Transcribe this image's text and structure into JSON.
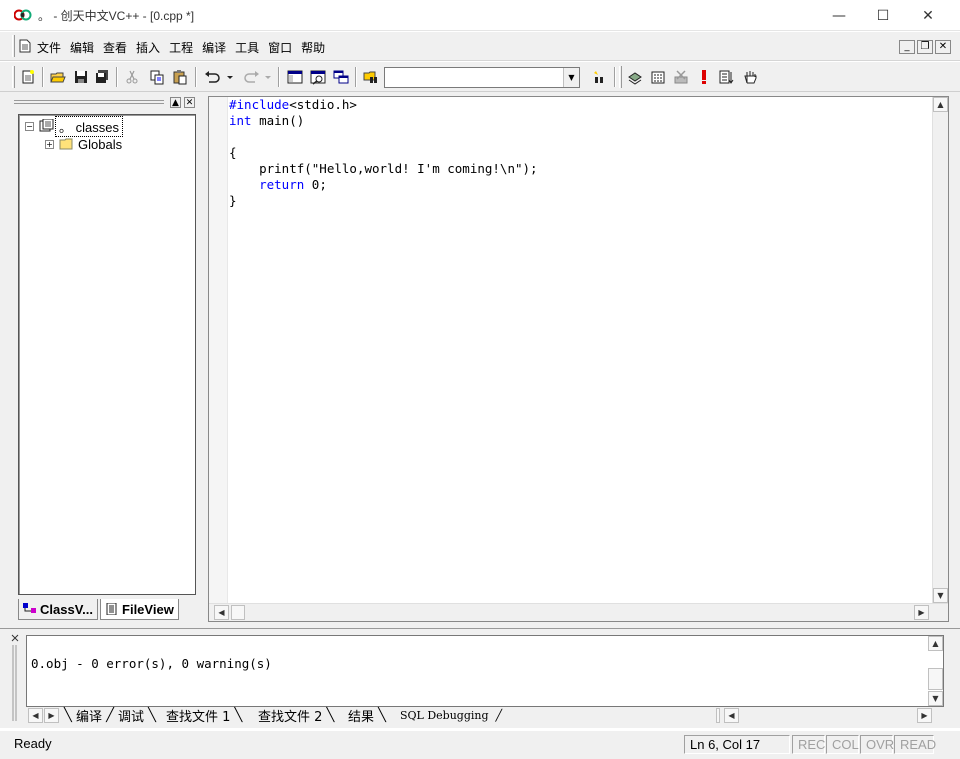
{
  "window": {
    "title": "。 - 创天中文VC++ - [0.cpp *]",
    "minimize_glyph": "—",
    "maximize_glyph": "☐",
    "close_glyph": "✕"
  },
  "menu": {
    "items": [
      "文件",
      "编辑",
      "查看",
      "插入",
      "工程",
      "编译",
      "工具",
      "窗口",
      "帮助"
    ],
    "mdi_minimize": "_",
    "mdi_restore": "❐",
    "mdi_close": "✕"
  },
  "toolbar": {
    "combo_value": "",
    "icons": [
      "new-file-icon",
      "open-folder-icon",
      "save-icon",
      "save-all-icon",
      "cut-icon",
      "copy-icon",
      "paste-icon",
      "undo-icon",
      "redo-icon",
      "workspace-icon",
      "output-window-icon",
      "window-list-icon",
      "find-in-files-icon",
      "find-icon",
      "compile-icon",
      "build-icon",
      "stop-build-icon",
      "execute-icon",
      "go-icon",
      "breakpoint-icon"
    ]
  },
  "workspace": {
    "tree": {
      "root_label": "。 classes",
      "child_label": "Globals"
    },
    "tabs": [
      "ClassV...",
      "FileView"
    ]
  },
  "editor": {
    "lines": [
      {
        "kw": "#include",
        "rest": "<stdio.h>"
      },
      {
        "kw": "int",
        "rest": " main()"
      },
      {
        "kw": "",
        "rest": ""
      },
      {
        "kw": "",
        "rest": "{"
      },
      {
        "kw": "",
        "rest": "    printf(\"Hello,world! I'm coming!\\n\");"
      },
      {
        "kw": "    return",
        "rest": " 0;"
      },
      {
        "kw": "",
        "rest": "}"
      }
    ]
  },
  "output": {
    "text": "0.obj - 0 error(s), 0 warning(s)",
    "tabs": [
      "编译",
      "调试",
      "查找文件 1",
      "查找文件 2",
      "结果",
      "SQL Debugging"
    ]
  },
  "status": {
    "ready": "Ready",
    "position": "Ln 6, Col 17",
    "rec": "REC",
    "col": "COL",
    "ovr": "OVR",
    "read": "READ"
  },
  "colors": {
    "keyword": "#0000ff",
    "chrome": "#f0f0f0"
  }
}
